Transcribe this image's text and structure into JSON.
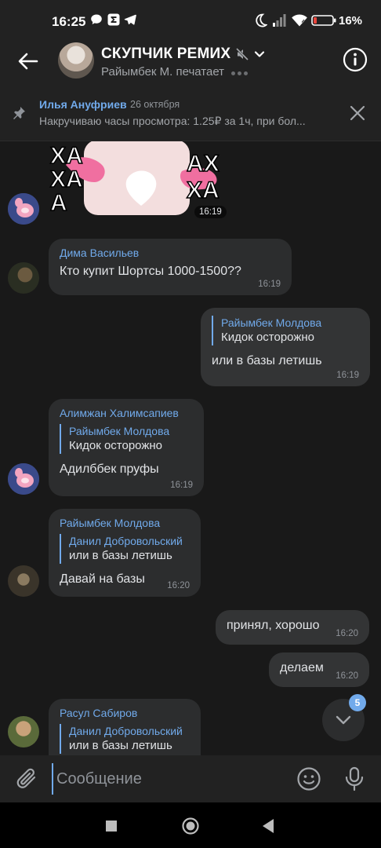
{
  "status_bar": {
    "time": "16:25",
    "battery": "16%"
  },
  "header": {
    "title": "СКУПЧИК РЕМИХ",
    "status": "Райымбек М. печатает"
  },
  "pinned": {
    "author": "Илья Ануфриев",
    "date": "26 октября",
    "text": "Накручиваю часы просмотра: 1.25₽ за 1ч, при бол..."
  },
  "messages": [
    {
      "type": "sticker",
      "time": "16:19"
    },
    {
      "author": "Дима Васильев",
      "text": "Кто купит Шортсы 1000-1500??",
      "time": "16:19"
    },
    {
      "outgoing": true,
      "reply_author": "Райымбек Молдова",
      "reply_text": "Кидок осторожно",
      "text": "или в базы летишь",
      "time": "16:19"
    },
    {
      "author": "Алимжан Халимсапиев",
      "reply_author": "Райымбек Молдова",
      "reply_text": "Кидок осторожно",
      "text": "Адилббек пруфы",
      "time": "16:19"
    },
    {
      "author": "Райымбек Молдова",
      "reply_author": "Данил Добровольский",
      "reply_text": "или в базы летишь",
      "text": "Давай на базы",
      "time": "16:20"
    },
    {
      "outgoing": true,
      "text": "принял, хорошо",
      "time": "16:20"
    },
    {
      "outgoing": true,
      "text": "делаем",
      "time": "16:20"
    },
    {
      "author": "Расул Сабиров",
      "reply_author": "Данил Добровольский",
      "reply_text": "или в базы летишь"
    }
  ],
  "scroll_badge": "5",
  "composer": {
    "placeholder": "Сообщение"
  },
  "colors": {
    "accent": "#71aaeb",
    "bubble_in": "#2c2d2e",
    "bubble_out": "#333435",
    "background": "#191919"
  }
}
